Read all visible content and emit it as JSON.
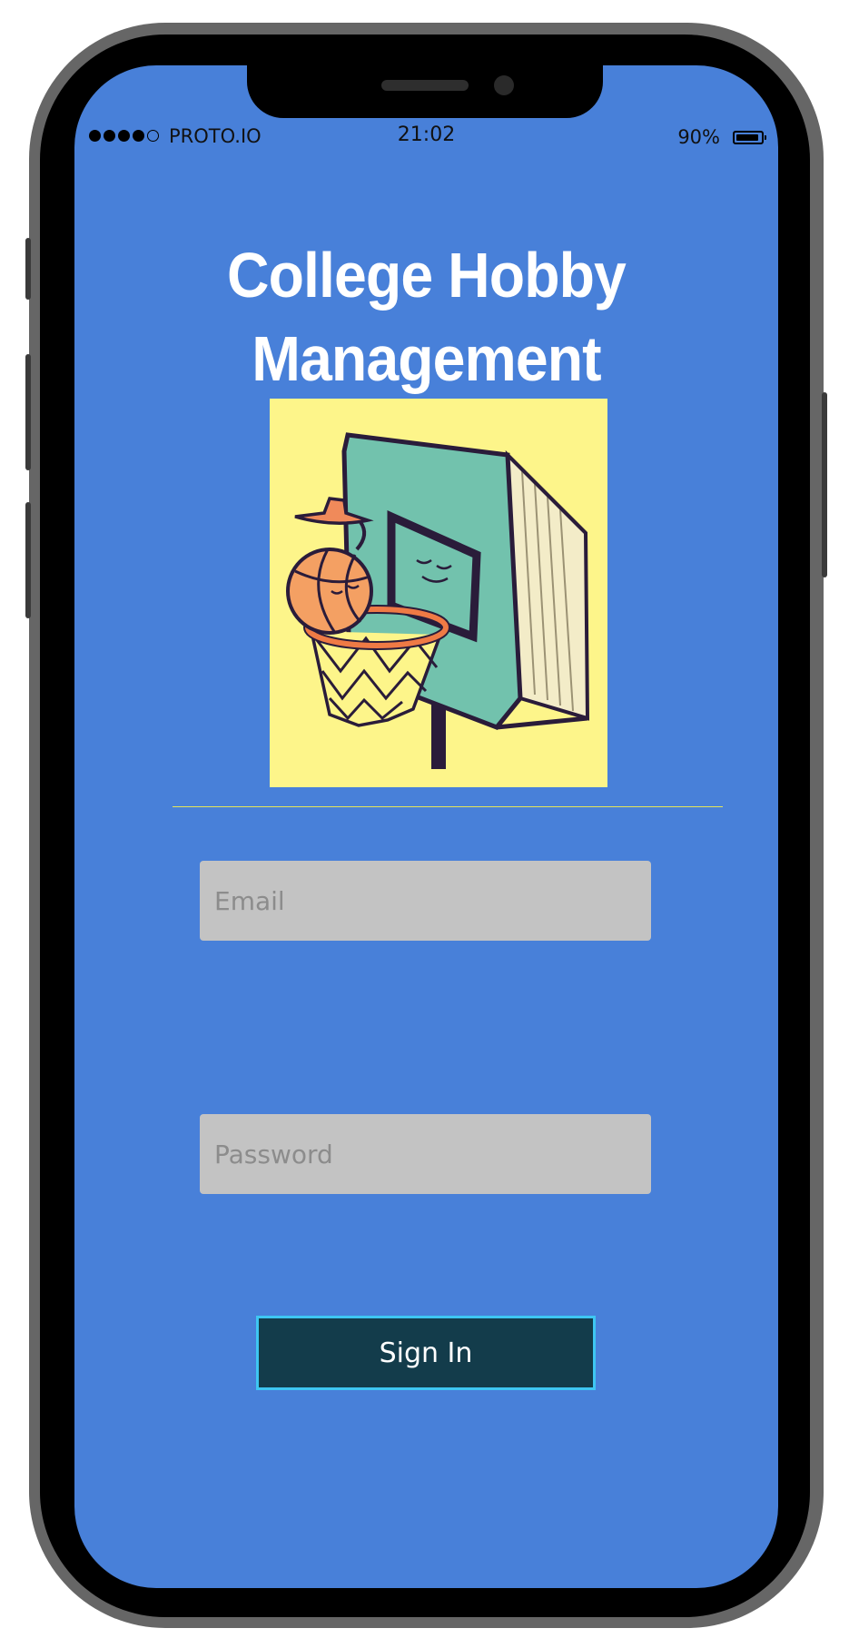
{
  "status_bar": {
    "signal_bars": 5,
    "signal_filled": 4,
    "carrier": "PROTO.IO",
    "time": "21:02",
    "battery_percent": "90%"
  },
  "login": {
    "title_line1": "College Hobby",
    "title_line2": "Management",
    "illustration": "basketball-hoop-book-icon",
    "email_placeholder": "Email",
    "password_placeholder": "Password",
    "sign_in_label": "Sign In"
  },
  "colors": {
    "screen_background": "#4880d9",
    "illustration_background": "#fdf58a",
    "divider": "#e6e65a",
    "input_background": "#c3c3c3",
    "button_background": "#133c4b",
    "button_border": "#3ec6f2"
  }
}
